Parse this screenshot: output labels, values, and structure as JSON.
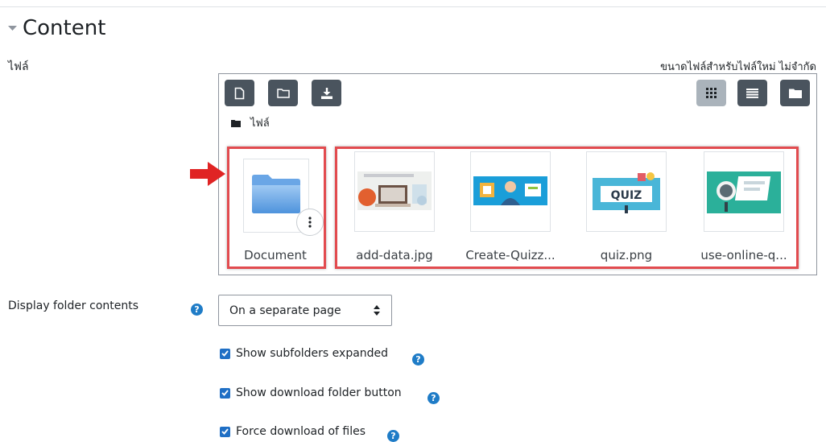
{
  "section": {
    "title": "Content",
    "caret_icon": "caret-down-icon"
  },
  "files_field": {
    "label": "ไฟล์",
    "size_limit": "ขนาดไฟล์สำหรับไฟล์ใหม่ ไม่จำกัด",
    "toolbar": {
      "left_buttons": [
        "add-file-icon",
        "create-folder-icon",
        "download-icon"
      ],
      "right_buttons": [
        "icon-view-icon",
        "list-view-icon",
        "tree-view-icon"
      ],
      "active_view": "icon-view"
    },
    "breadcrumb": "ไฟล์",
    "items": [
      {
        "name": "Document",
        "type": "folder"
      },
      {
        "name": "add-data.jpg",
        "type": "image"
      },
      {
        "name": "Create-Quizz...",
        "type": "image"
      },
      {
        "name": "quiz.png",
        "type": "image"
      },
      {
        "name": "use-online-q...",
        "type": "image"
      }
    ],
    "quiz_thumb_text": "QUIZ",
    "annotation_color": "#e24b4f"
  },
  "display_contents": {
    "label": "Display folder contents",
    "selected": "On a separate page"
  },
  "options": [
    {
      "label": "Show subfolders expanded",
      "checked": true
    },
    {
      "label": "Show download folder button",
      "checked": true
    },
    {
      "label": "Force download of files",
      "checked": true
    }
  ],
  "colors": {
    "accent": "#1f6fc5",
    "toolbar": "#4a545e",
    "help": "#1f7cc7"
  }
}
